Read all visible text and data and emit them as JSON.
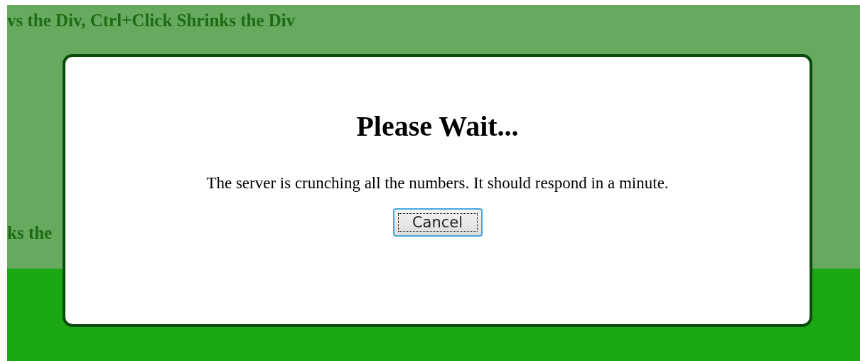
{
  "page": {
    "lines": [
      "vs the Div, Ctrl+Click Shrinks the Div",
      "ks the"
    ]
  },
  "dialog": {
    "title": "Please Wait...",
    "message": "The server is crunching all the numbers. It should respond in a minute.",
    "button": "Cancel"
  }
}
